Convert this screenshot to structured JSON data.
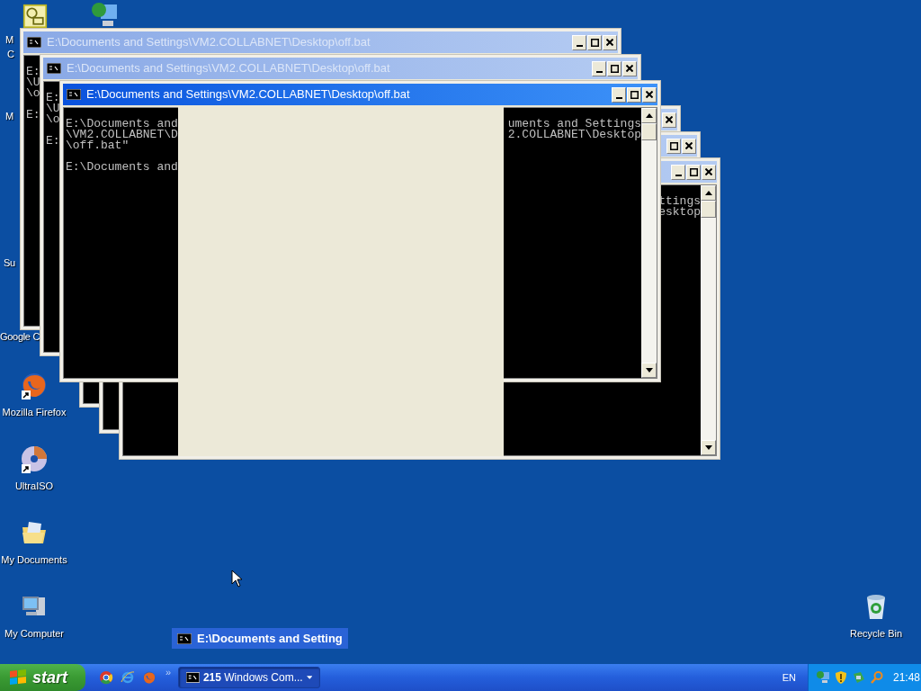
{
  "desktop": {
    "partial_icons": [
      {
        "kind": "scheduler"
      },
      {
        "kind": "network"
      }
    ],
    "partial_labels": [
      "M",
      "C",
      "M",
      "Su",
      "Google C"
    ],
    "icons": [
      {
        "kind": "firefox",
        "label": "Mozilla Firefox"
      },
      {
        "kind": "disc",
        "label": "UltraISO"
      },
      {
        "kind": "documents",
        "label": "My Documents"
      },
      {
        "kind": "computer",
        "label": "My Computer"
      },
      {
        "kind": "recycle",
        "label": "Recycle Bin"
      }
    ]
  },
  "windows": [
    {
      "title": "E:\\Documents and Settings\\VM2.COLLABNET\\Desktop\\off.bat",
      "active": false,
      "left_blocks": [
        [
          "E:",
          "\\U",
          "\\o"
        ],
        [
          "E:"
        ]
      ]
    },
    {
      "title": "E:\\Documents and Settings\\VM2.COLLABNET\\Desktop\\off.bat",
      "active": false,
      "left_blocks": [
        [
          "E:",
          "\\U",
          "\\o"
        ],
        [
          "E:"
        ]
      ]
    },
    {
      "title": "E:\\Documents and Settings\\VM2.COLLABNET\\Desktop\\off.bat",
      "active": true,
      "left_blocks": [
        [
          "E:\\Documents and",
          "\\VM2.COLLABNET\\D",
          "\\off.bat\""
        ],
        [
          "E:\\Documents and"
        ]
      ],
      "right_lines": [
        "uments and Settings",
        "2.COLLABNET\\Desktop"
      ]
    },
    {
      "active": false
    },
    {
      "active": false
    },
    {
      "active": false,
      "right_lines": [
        "ttings",
        "esktop"
      ]
    }
  ],
  "drag_label": "E:\\Documents and Setting",
  "taskbar": {
    "start": "start",
    "quick_launch": [
      {
        "kind": "chrome"
      },
      {
        "kind": "ie"
      },
      {
        "kind": "firefox"
      }
    ],
    "chevron": "»",
    "tasks": [
      {
        "label": "**215** Windows Com...",
        "selected": true
      }
    ],
    "language": "EN",
    "tray_icons": [
      {
        "kind": "network"
      },
      {
        "kind": "shield"
      },
      {
        "kind": "device"
      },
      {
        "kind": "search"
      }
    ],
    "clock": "21:48"
  }
}
